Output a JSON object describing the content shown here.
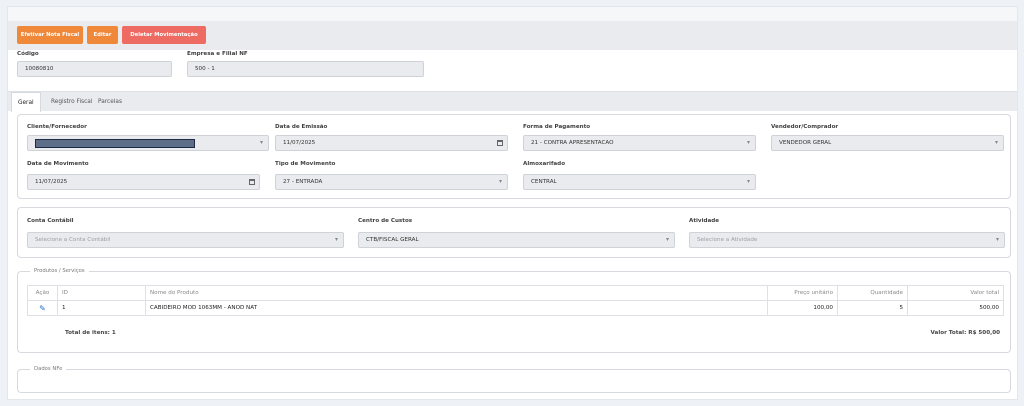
{
  "toolbar": {
    "efetivar_label": "Efetivar Nota Fiscal",
    "editar_label": "Editar",
    "deletar_label": "Deletar Movimentação"
  },
  "header": {
    "codigo_label": "Código",
    "codigo_value": "10080810",
    "empresa_label": "Empresa e Filial NF",
    "empresa_value": "500 - 1"
  },
  "tabs": [
    {
      "label": "Geral",
      "active": true
    },
    {
      "label": "Registro Fiscal",
      "active": false
    },
    {
      "label": "Parcelas",
      "active": false
    }
  ],
  "geral": {
    "cliente_label": "Cliente/Fornecedor",
    "cliente_value": "",
    "data_emissao_label": "Data de Emissão",
    "data_emissao_value": "11/07/2025",
    "forma_pagamento_label": "Forma de Pagamento",
    "forma_pagamento_value": "21 - CONTRA APRESENTACAO",
    "vendedor_label": "Vendedor/Comprador",
    "vendedor_value": "VENDEDOR GERAL",
    "data_movimento_label": "Data de Movimento",
    "data_movimento_value": "11/07/2025",
    "tipo_movimento_label": "Tipo de Movimento",
    "tipo_movimento_value": "27 - ENTRADA",
    "almoxarifado_label": "Almoxarifado",
    "almoxarifado_value": "CENTRAL"
  },
  "contabil": {
    "conta_label": "Conta Contábil",
    "conta_placeholder": "Selecione a Conta Contábil",
    "centro_label": "Centro de Custos",
    "centro_value": "CTB/FISCAL GERAL",
    "atividade_label": "Atividade",
    "atividade_placeholder": "Selecione a Atividade"
  },
  "produtos": {
    "legend": "Produtos / Serviços",
    "columns": [
      "Ação",
      "ID",
      "Nome do Produto",
      "Preço unitário",
      "Quantidade",
      "Valor total"
    ],
    "rows": [
      {
        "id": "1",
        "nome": "CABIDEIRO MOD 1063MM - ANOD NAT",
        "preco": "100,00",
        "quantidade": "5",
        "valor": "500,00"
      }
    ],
    "total_items": "Total de itens: 1",
    "valor_total": "Valor Total: R$ 500,00"
  },
  "dados_nfe": {
    "legend": "Dados NFe"
  },
  "colors": {
    "accent_orange": "#f0883a",
    "accent_red": "#ee6b64",
    "edit_icon": "#1e6fc9",
    "redaction": "#5d6e89"
  }
}
